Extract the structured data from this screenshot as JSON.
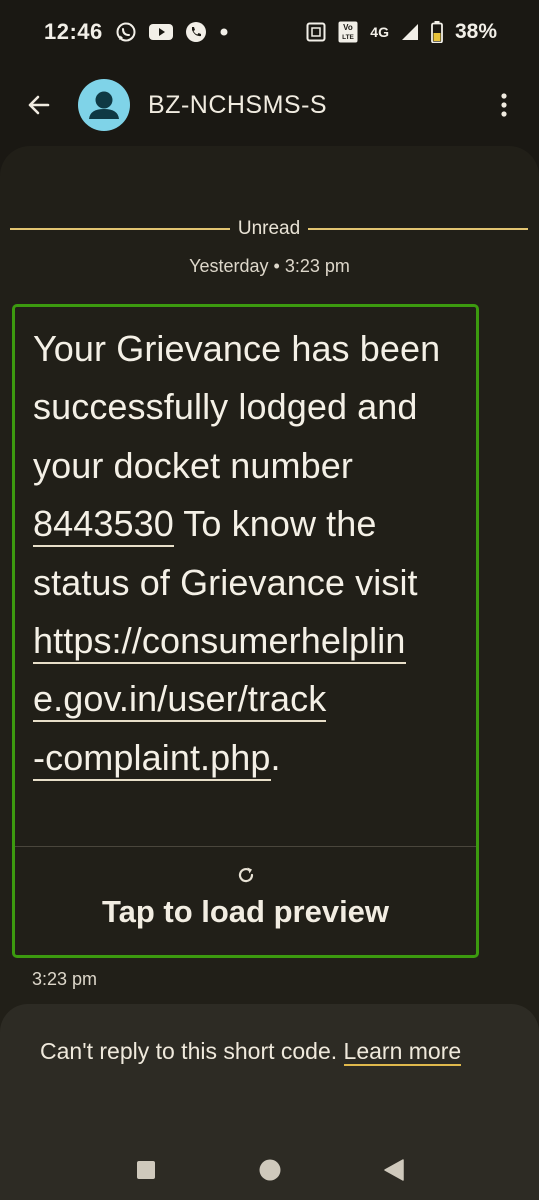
{
  "status_bar": {
    "time": "12:46",
    "network": "4G",
    "volte_top": "Vo",
    "volte_bottom": "LTE",
    "battery": "38%",
    "left_icons": [
      "whatsapp-icon",
      "youtube-icon",
      "phone-call-icon",
      "notification-dot-icon"
    ],
    "right_icons": [
      "nfc-icon",
      "volte-icon",
      "signal-icon",
      "battery-icon"
    ]
  },
  "app_bar": {
    "title": "BZ-NCHSMS-S",
    "avatar_color": "#7fd3e8"
  },
  "conversation": {
    "unread_label": "Unread",
    "timestamp_header": "Yesterday • 3:23 pm",
    "message": {
      "text_before": "Your Grievance has been successfully lodged and your docket number ",
      "docket_number": "8443530",
      "text_middle": " To know the status of Grievance visit ",
      "url_line_1": "https://consumerhelplin",
      "url_line_2": "e.gov.in/user/track",
      "url_line_3": "-complaint.php",
      "text_after": ".",
      "time": "3:23 pm"
    },
    "preview": {
      "label": "Tap to load preview"
    }
  },
  "reply_panel": {
    "text": "Can't reply to this short code. ",
    "link_label": "Learn more"
  },
  "colors": {
    "highlight_border": "#3c9a0f",
    "unread_line": "#e2c472",
    "link_underline": "#e0b94c"
  }
}
